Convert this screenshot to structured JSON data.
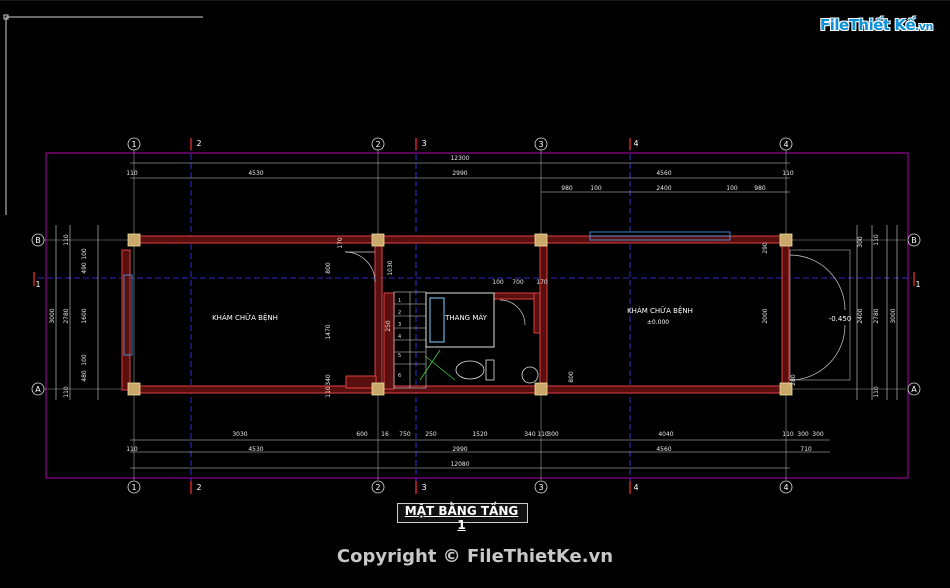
{
  "brand": {
    "logo_main": "File",
    "logo_rest": "Thiết Kế",
    "logo_domain": ".vn"
  },
  "drawing": {
    "title": "MẶT BẰNG TẦNG 1",
    "copyright": "Copyright © FileThietKe.vn",
    "rooms": {
      "left": "KHÁM CHỮA BỆNH",
      "right": "KHÁM CHỮA BỆNH",
      "elevator": "THANG MÁY"
    },
    "levels": {
      "floor": "±0.000",
      "outdoor": "-0.450"
    },
    "grid_columns_top": [
      "1",
      "2",
      "2",
      "3",
      "3",
      "4",
      "4"
    ],
    "grid_columns_bottom": [
      "1",
      "2",
      "2",
      "3",
      "3",
      "4",
      "4"
    ],
    "grid_rows": [
      "B",
      "1",
      "A"
    ],
    "dims_top_total": "12300",
    "dims_top_row1": [
      "110",
      "4530",
      "2990",
      "4560",
      "110"
    ],
    "dims_top_row2": [
      "980",
      "100",
      "2400",
      "100",
      "980"
    ],
    "dims_bottom_row1": [
      "3030",
      "600",
      "16",
      "750",
      "250",
      "1520",
      "340",
      "110",
      "300",
      "4040",
      "110",
      "300",
      "300"
    ],
    "dims_bottom_row2": [
      "110",
      "4530",
      "2990",
      "4560",
      "710"
    ],
    "dims_bottom_total": "12080",
    "dims_left": [
      "3000",
      "2780",
      "1600",
      "110",
      "100",
      "490",
      "480",
      "110",
      "100"
    ],
    "dims_right": [
      "300",
      "2400",
      "3000",
      "2780",
      "110",
      "280",
      "110"
    ],
    "dims_interior": [
      "170",
      "1030",
      "800",
      "1470",
      "340",
      "110",
      "100",
      "700",
      "170",
      "2000",
      "800",
      "250",
      "290"
    ],
    "stair_numbers": [
      "1",
      "2",
      "3",
      "4",
      "5",
      "6"
    ]
  }
}
